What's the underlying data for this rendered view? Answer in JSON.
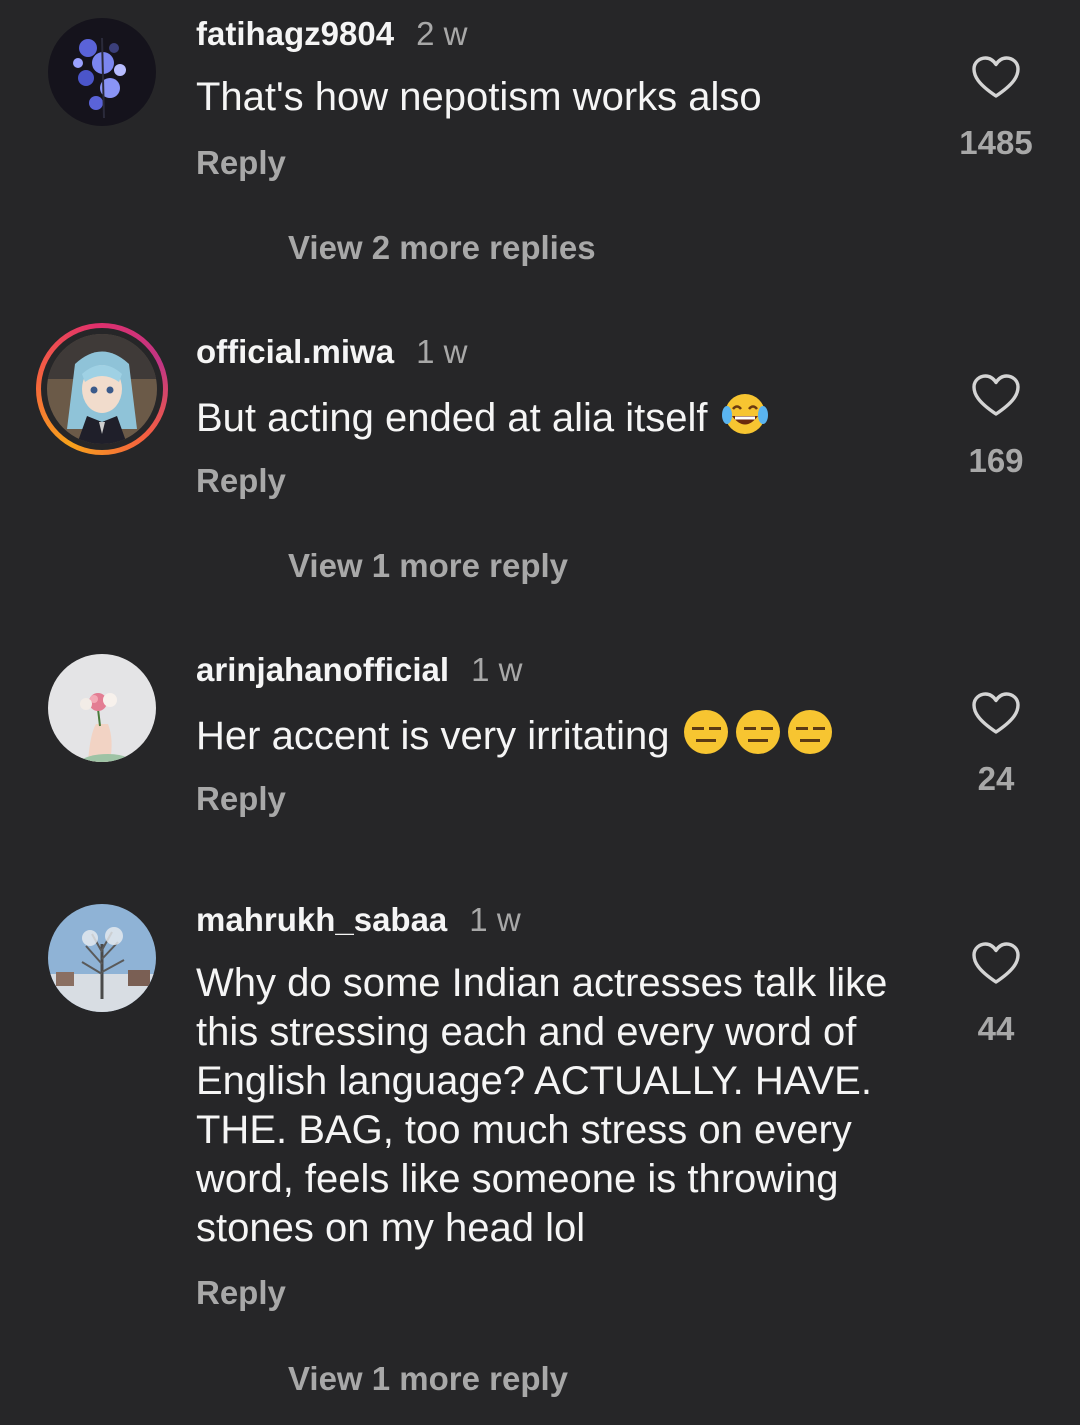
{
  "comments": [
    {
      "username": "fatihagz9804",
      "time": "2 w",
      "text": "That's how nepotism works also",
      "reply_label": "Reply",
      "likes": "1485",
      "view_more": "View 2 more replies",
      "avatar_icon": "flowers-avatar"
    },
    {
      "username": "official.miwa",
      "time": "1 w",
      "text": "But acting ended at alia itself",
      "emoji": "😂",
      "reply_label": "Reply",
      "likes": "169",
      "view_more": "View 1 more reply",
      "avatar_icon": "anime-girl-avatar",
      "story_ring": true
    },
    {
      "username": "arinjahanofficial",
      "time": "1 w",
      "text": "Her accent is very irritating",
      "emoji": "😑😑😑",
      "reply_label": "Reply",
      "likes": "24",
      "avatar_icon": "rose-hand-avatar"
    },
    {
      "username": "mahrukh_sabaa",
      "time": "1 w",
      "text": "Why do some Indian actresses talk like this stressing each and every word of English language? ACTUALLY. HAVE. THE. BAG, too much stress on every word, feels like someone is throwing stones on my head lol",
      "reply_label": "Reply",
      "likes": "44",
      "view_more": "View 1 more reply",
      "avatar_icon": "winter-tree-avatar"
    }
  ],
  "colors": {
    "background": "#262628",
    "primary_text": "#f5f5f5",
    "secondary_text": "#a8a8a8"
  }
}
